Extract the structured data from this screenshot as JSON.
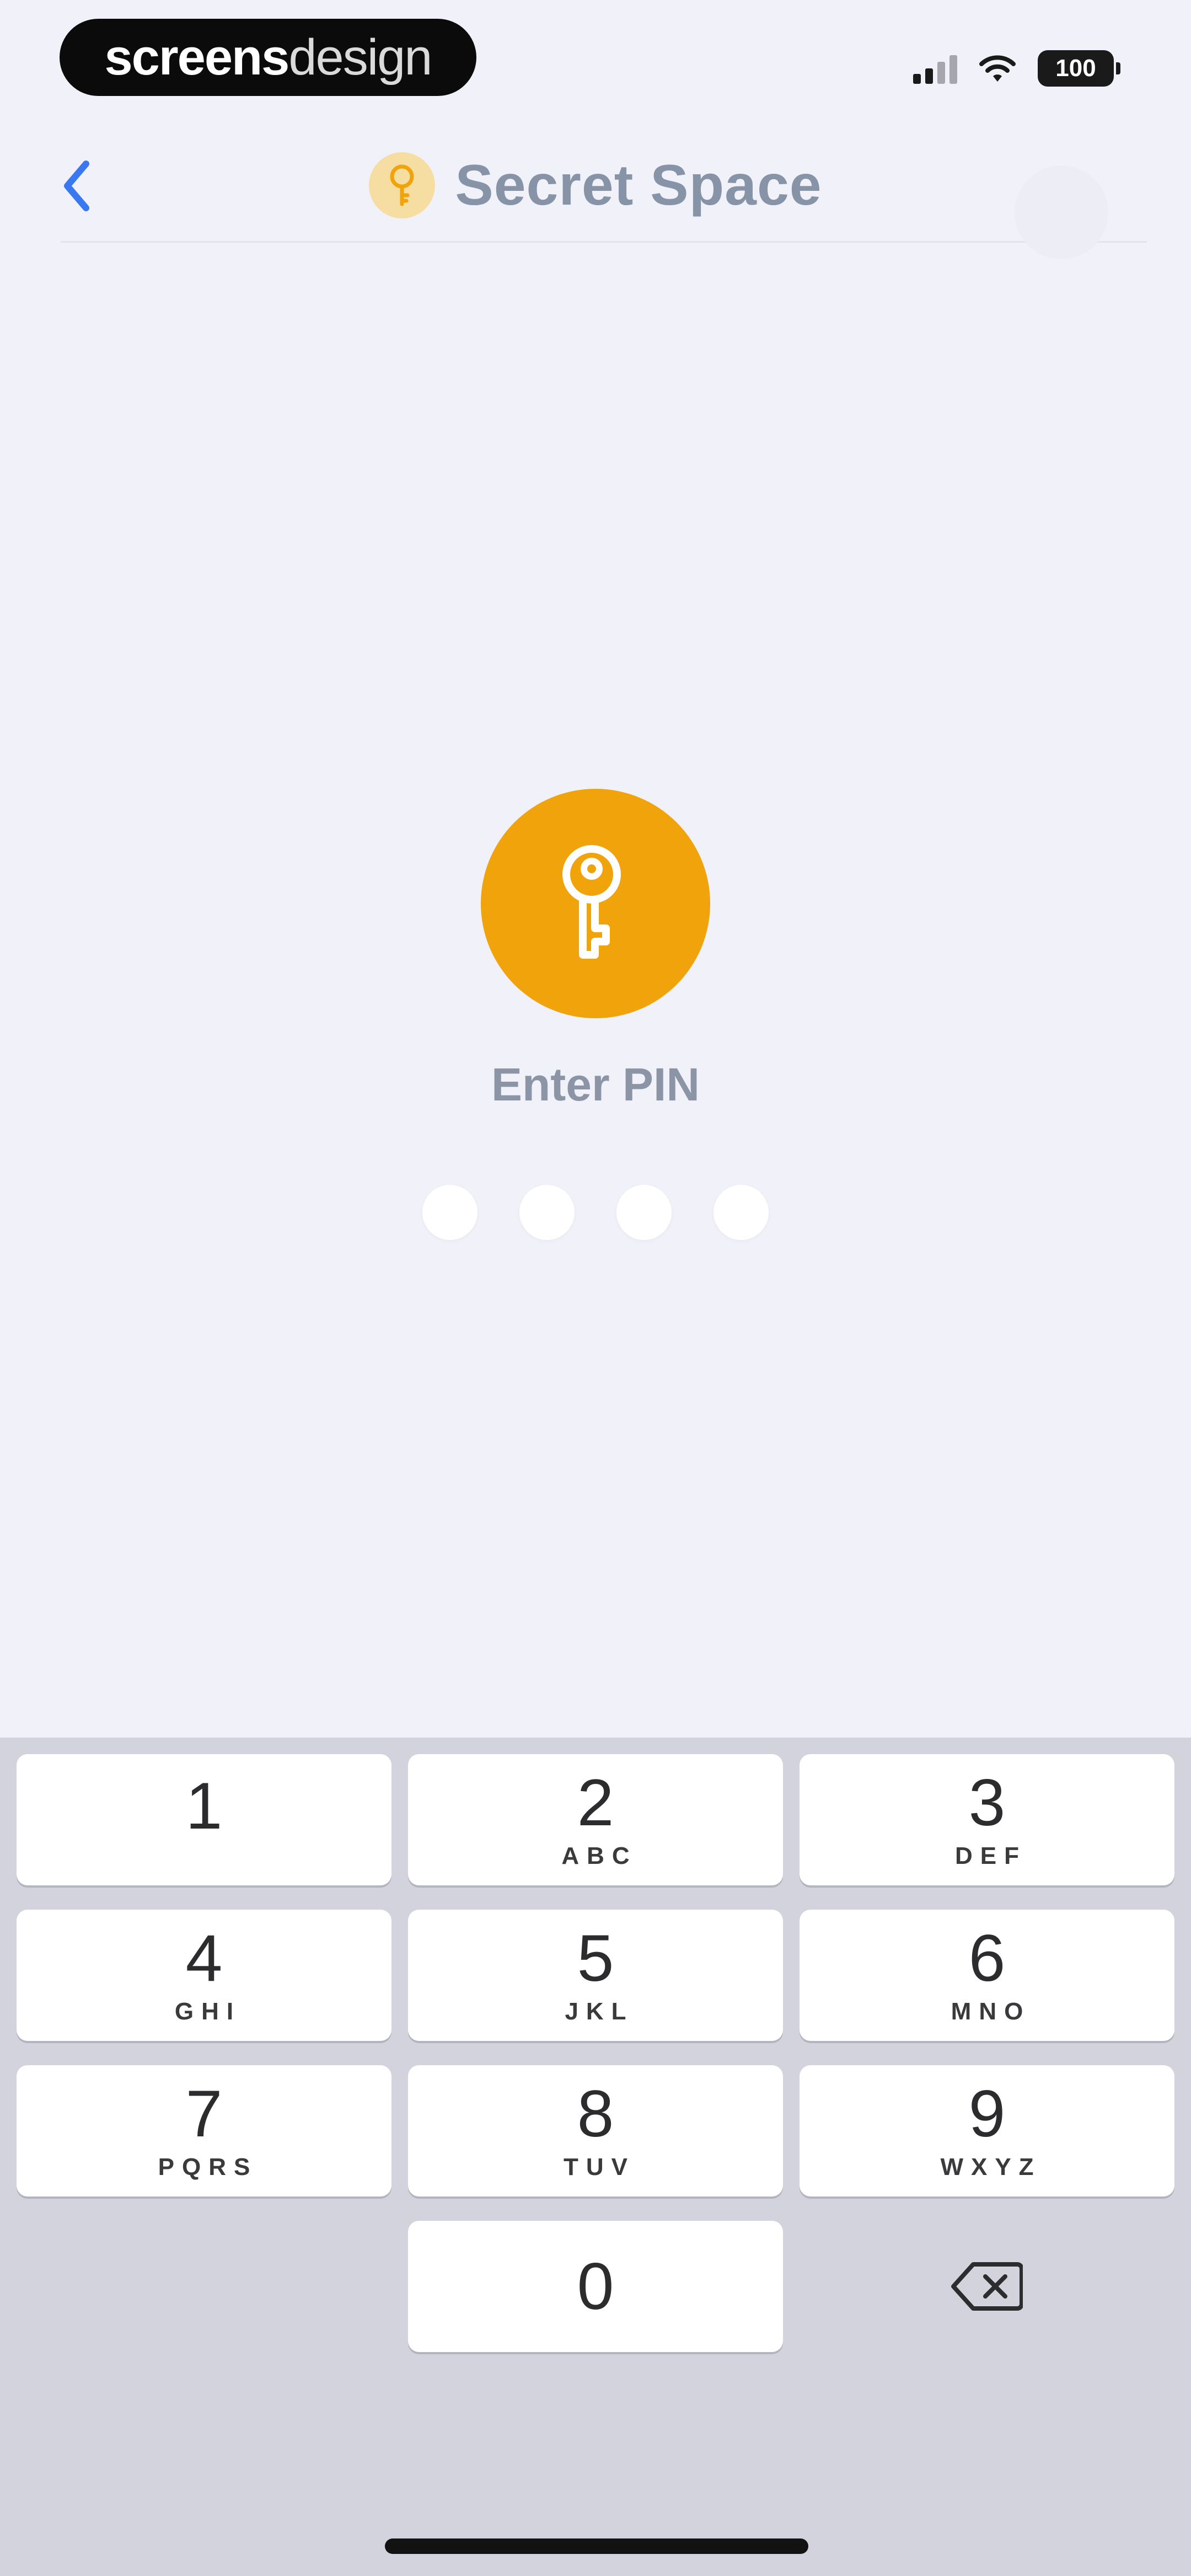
{
  "status_bar": {
    "watermark_bold": "screens",
    "watermark_light": "design",
    "battery": "100",
    "signal_icon": "cellular-signal-icon",
    "wifi_icon": "wifi-icon"
  },
  "nav": {
    "title": "Secret Space",
    "back_icon": "chevron-left-icon",
    "title_icon": "key-icon"
  },
  "main": {
    "icon": "key-icon",
    "prompt": "Enter PIN",
    "pin_length": 4,
    "entered": 0
  },
  "keypad": {
    "keys": [
      {
        "num": "1",
        "letters": ""
      },
      {
        "num": "2",
        "letters": "ABC"
      },
      {
        "num": "3",
        "letters": "DEF"
      },
      {
        "num": "4",
        "letters": "GHI"
      },
      {
        "num": "5",
        "letters": "JKL"
      },
      {
        "num": "6",
        "letters": "MNO"
      },
      {
        "num": "7",
        "letters": "PQRS"
      },
      {
        "num": "8",
        "letters": "TUV"
      },
      {
        "num": "9",
        "letters": "WXYZ"
      },
      {
        "num": "0",
        "letters": ""
      }
    ],
    "delete_icon": "backspace-icon"
  },
  "colors": {
    "accent": "#f0a30a",
    "back_blue": "#3a78f2",
    "background": "#f1f1fa",
    "keypad_bg": "#d2d3dd"
  }
}
